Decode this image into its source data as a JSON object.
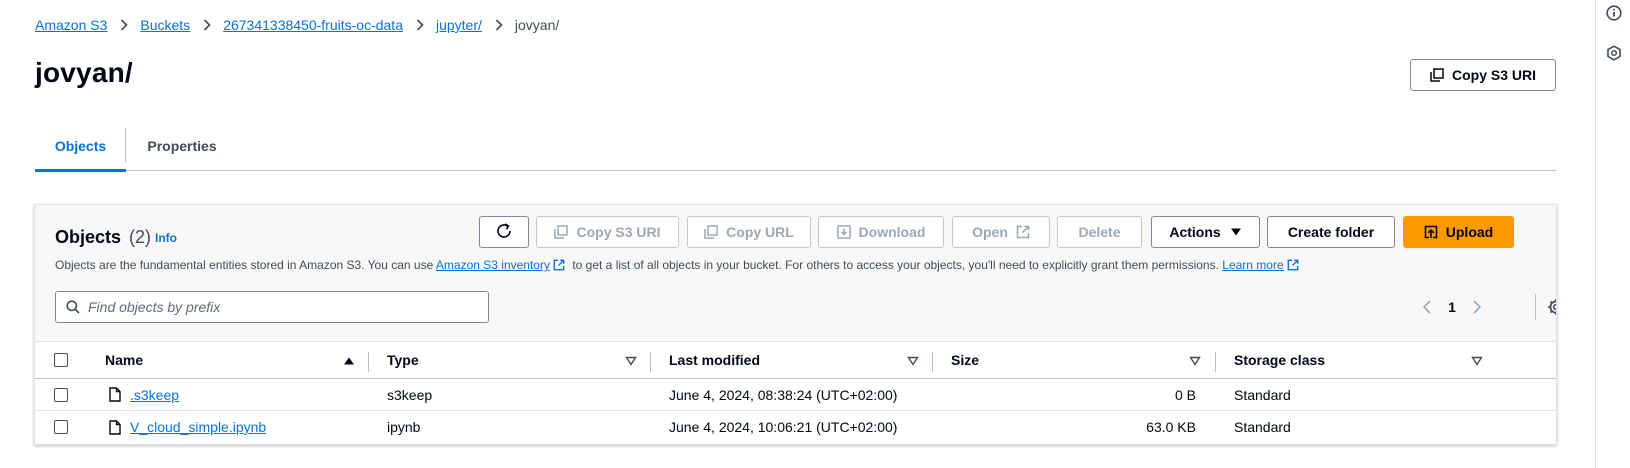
{
  "breadcrumb": {
    "items": [
      "Amazon S3",
      "Buckets",
      "267341338450-fruits-oc-data",
      "jupyter/"
    ],
    "current": "jovyan/"
  },
  "page": {
    "title": "jovyan/",
    "copy_s3_uri_label": "Copy S3 URI"
  },
  "tabs": [
    "Objects",
    "Properties"
  ],
  "objects": {
    "heading": "Objects",
    "count": "(2)",
    "info": "Info",
    "toolbar": {
      "copy_s3_uri": "Copy S3 URI",
      "copy_url": "Copy URL",
      "download": "Download",
      "open": "Open",
      "delete": "Delete",
      "actions": "Actions",
      "create_folder": "Create folder",
      "upload": "Upload"
    },
    "description": {
      "part1": "Objects are the fundamental entities stored in Amazon S3. You can use",
      "link1": "Amazon S3 inventory",
      "part2": "to get a list of all objects in your bucket. For others to access your objects, you'll need to explicitly grant them permissions.",
      "link2": "Learn more"
    },
    "search_placeholder": "Find objects by prefix",
    "pagination": {
      "current_page": "1"
    },
    "columns": [
      "Name",
      "Type",
      "Last modified",
      "Size",
      "Storage class"
    ],
    "rows": [
      {
        "name": ".s3keep",
        "type": "s3keep",
        "last_modified": "June 4, 2024, 08:38:24 (UTC+02:00)",
        "size": "0 B",
        "storage_class": "Standard"
      },
      {
        "name": "V_cloud_simple.ipynb",
        "type": "ipynb",
        "last_modified": "June 4, 2024, 10:06:21 (UTC+02:00)",
        "size": "63.0 KB",
        "storage_class": "Standard"
      }
    ]
  },
  "icons": {
    "breadcrumb_separator": "chevron-right-icon",
    "copy": "copy-icon",
    "refresh": "refresh-icon",
    "download": "download-icon",
    "external": "external-link-icon",
    "caret": "caret-down-icon",
    "upload": "upload-icon",
    "search": "search-icon",
    "settings": "gear-icon",
    "file": "file-icon",
    "info": "info-icon",
    "rail_second": "hexagon-icon"
  },
  "colors": {
    "link": "#0972d3",
    "primary_button": "#ff9900",
    "text": "#000716",
    "disabled": "#9ba7b6"
  }
}
